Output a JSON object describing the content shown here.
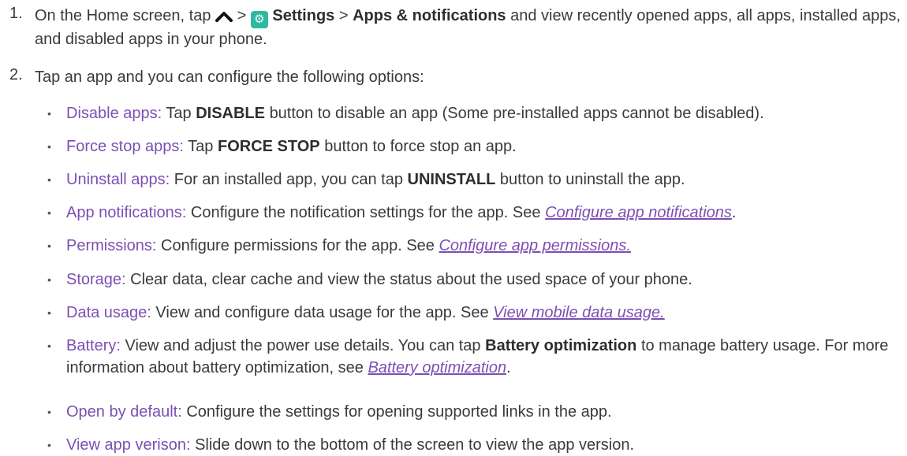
{
  "steps": [
    {
      "num": "1.",
      "pre": "On the Home screen, tap",
      "gt1": ">",
      "settings": "Settings",
      "gt2": ">",
      "apps": "Apps & notifications",
      "post": "and view recently opened apps, all apps, installed apps, and disabled apps in your phone."
    },
    {
      "num": "2.",
      "text": "Tap an app and you can configure the following options:"
    }
  ],
  "options": [
    {
      "label": "Disable apps:",
      "pre": "Tap",
      "bold": "DISABLE",
      "post": "button to disable an app (Some pre-installed apps cannot be disabled)."
    },
    {
      "label": "Force stop apps:",
      "pre": "Tap",
      "bold": "FORCE STOP",
      "post": "button to force stop an app."
    },
    {
      "label": "Uninstall apps:",
      "pre": "For an installed app, you can tap",
      "bold": "UNINSTALL",
      "post": "button to uninstall the app."
    },
    {
      "label": "App notifications:",
      "text": "Configure the notification settings for the app. See",
      "link": "Configure app notifications",
      "tail": "."
    },
    {
      "label": "Permissions:",
      "text": "Configure permissions for the app. See",
      "link": "Configure app permissions."
    },
    {
      "label": "Storage:",
      "text": "Clear data, clear cache and view the status about the used space of your phone."
    },
    {
      "label": "Data usage:",
      "text": "View and configure data usage for the app. See",
      "link": "View mobile data usage."
    },
    {
      "label": "Battery:",
      "pre": "View and adjust the power use details. You can tap",
      "bold": "Battery optimization",
      "post": "to manage battery usage. For more information about battery optimization, see",
      "link": "Battery optimization",
      "tail": "."
    },
    {
      "label": "Open by default:",
      "text": "Configure the settings for opening supported links in the app."
    },
    {
      "label": "View app verison:",
      "text": "Slide down to the bottom of the screen to view the app version."
    }
  ],
  "icons": {
    "up": "chevron-up-icon",
    "settings": "settings-gear-icon"
  },
  "colors": {
    "label": "#7c4fb3",
    "settings_icon": "#2fb9a0"
  }
}
